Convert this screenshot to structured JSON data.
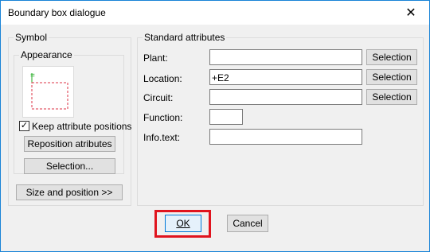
{
  "window": {
    "title": "Boundary box dialogue"
  },
  "symbol_group": {
    "label": "Symbol",
    "appearance_label": "Appearance",
    "preview_tag": "=",
    "keep_positions_label": "Keep attribute positions",
    "keep_positions_checked": true,
    "reposition_button": "Reposition atributes",
    "selection_button": "Selection...",
    "size_position_button": "Size and position >>"
  },
  "standard_group": {
    "label": "Standard attributes",
    "fields": [
      {
        "label": "Plant:",
        "value": "",
        "button": "Selection"
      },
      {
        "label": "Location:",
        "value": "+E2",
        "button": "Selection"
      },
      {
        "label": "Circuit:",
        "value": "",
        "button": "Selection"
      },
      {
        "label": "Function:",
        "value": ""
      },
      {
        "label": "Info.text:",
        "value": ""
      }
    ]
  },
  "footer": {
    "ok": "OK",
    "cancel": "Cancel"
  },
  "colors": {
    "highlight": "#e0141e",
    "preview_symbol": "#22aa22",
    "preview_box": "#dd3344"
  }
}
